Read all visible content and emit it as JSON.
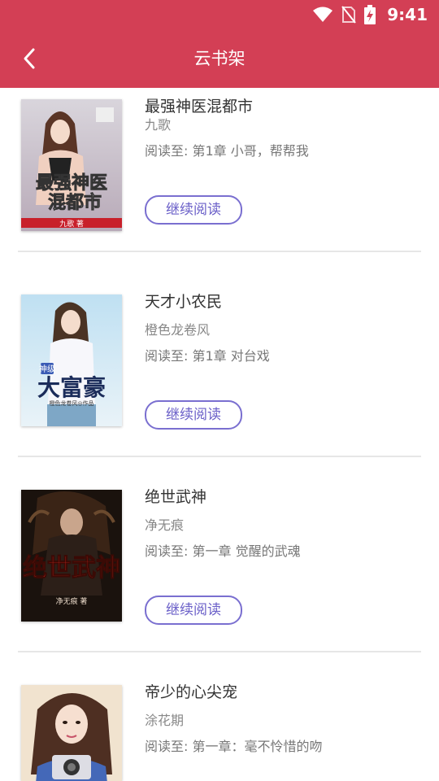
{
  "status_bar": {
    "time": "9:41"
  },
  "header": {
    "title": "云书架"
  },
  "shelf": {
    "continue_label": "继续阅读",
    "books": [
      {
        "title": "最强神医混都市",
        "author": "九歌",
        "progress": "阅读至: 第1章 小哥，帮帮我",
        "cover_title": "最强神医混都市",
        "cover_author_tag": "九歌 著"
      },
      {
        "title": "天才小农民",
        "author": "橙色龙卷风",
        "progress": "阅读至: 第1章 对台戏",
        "cover_title": "大富豪",
        "cover_badge": "神级",
        "cover_subtitle": "橙色龙卷风◎作品"
      },
      {
        "title": "绝世武神",
        "author": "净无痕",
        "progress": "阅读至: 第一章 觉醒的武魂",
        "cover_title": "绝世武神",
        "cover_author_tag": "净无痕 著"
      },
      {
        "title": "帝少的心尖宠",
        "author": "涂花期",
        "progress": "阅读至: 第一章：毫不怜惜的吻"
      }
    ]
  },
  "colors": {
    "header_bg": "#d33f55",
    "button_border": "#7a6fd0",
    "divider": "#e6e6e6"
  }
}
